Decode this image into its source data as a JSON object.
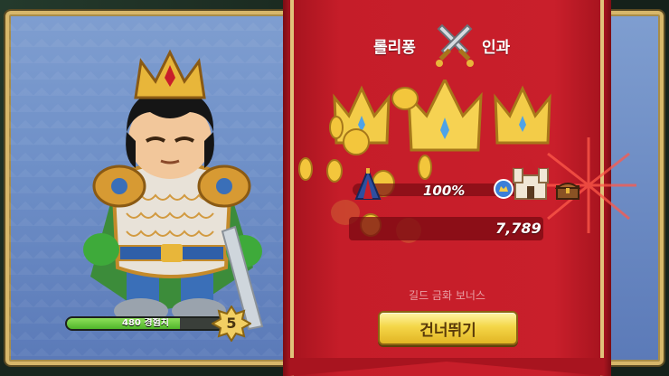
{
  "hero": {
    "xp_label": "480 경험치",
    "xp_progress": 0.72,
    "level": "5"
  },
  "result": {
    "title_left": "롤리퐁",
    "title_right": "인과",
    "percent": "100%",
    "total": "7,789",
    "guild_bonus": "길드 금화 보너스",
    "skip_label": "건너뛰기"
  },
  "colors": {
    "banner_red": "#c51d29",
    "gold": "#f4d648",
    "xp_green": "#4fb52a",
    "card_blue": "#6e8fc7"
  },
  "icons": [
    "crossed-swords-icon",
    "crown-icon",
    "coin-icon",
    "castle-icon",
    "chest-icon",
    "tent-icon",
    "medal-icon",
    "star-badge-icon"
  ]
}
